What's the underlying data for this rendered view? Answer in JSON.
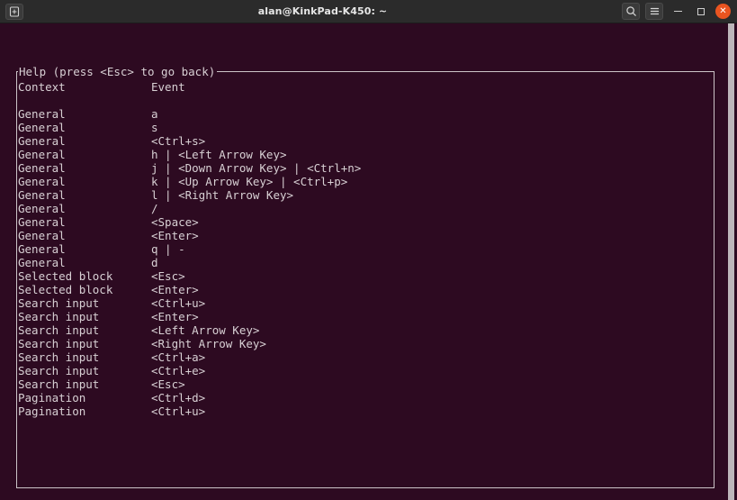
{
  "window": {
    "title": "alan@KinkPad-K450: ~",
    "titlebar": {
      "new_tab_icon": "new-tab-icon",
      "search_icon": "search-icon",
      "menu_icon": "hamburger-menu-icon",
      "minimize_icon": "minimize-icon",
      "maximize_icon": "maximize-icon",
      "close_icon": "close-icon",
      "close_glyph": "✕"
    },
    "colors": {
      "titlebar_bg": "#2b2b2b",
      "terminal_bg": "#2d0a21",
      "text": "#d8d0d4",
      "border": "#ccc4c8",
      "close_button": "#e95420",
      "scrollbar": "#bdb6ba"
    }
  },
  "help": {
    "box_title": "Help (press <Esc> to go back)",
    "columns": {
      "context": "Context",
      "event": "Event"
    },
    "rows": [
      {
        "context": "General",
        "event": "a"
      },
      {
        "context": "General",
        "event": "s"
      },
      {
        "context": "General",
        "event": "<Ctrl+s>"
      },
      {
        "context": "General",
        "event": "h | <Left Arrow Key>"
      },
      {
        "context": "General",
        "event": "j | <Down Arrow Key> | <Ctrl+n>"
      },
      {
        "context": "General",
        "event": "k | <Up Arrow Key> | <Ctrl+p>"
      },
      {
        "context": "General",
        "event": "l | <Right Arrow Key>"
      },
      {
        "context": "General",
        "event": "/"
      },
      {
        "context": "General",
        "event": "<Space>"
      },
      {
        "context": "General",
        "event": "<Enter>"
      },
      {
        "context": "General",
        "event": "q | -"
      },
      {
        "context": "General",
        "event": "d"
      },
      {
        "context": "Selected block",
        "event": "<Esc>"
      },
      {
        "context": "Selected block",
        "event": "<Enter>"
      },
      {
        "context": "Search input",
        "event": "<Ctrl+u>"
      },
      {
        "context": "Search input",
        "event": "<Enter>"
      },
      {
        "context": "Search input",
        "event": "<Left Arrow Key>"
      },
      {
        "context": "Search input",
        "event": "<Right Arrow Key>"
      },
      {
        "context": "Search input",
        "event": "<Ctrl+a>"
      },
      {
        "context": "Search input",
        "event": "<Ctrl+e>"
      },
      {
        "context": "Search input",
        "event": "<Esc>"
      },
      {
        "context": "Pagination",
        "event": "<Ctrl+d>"
      },
      {
        "context": "Pagination",
        "event": "<Ctrl+u>"
      }
    ]
  }
}
